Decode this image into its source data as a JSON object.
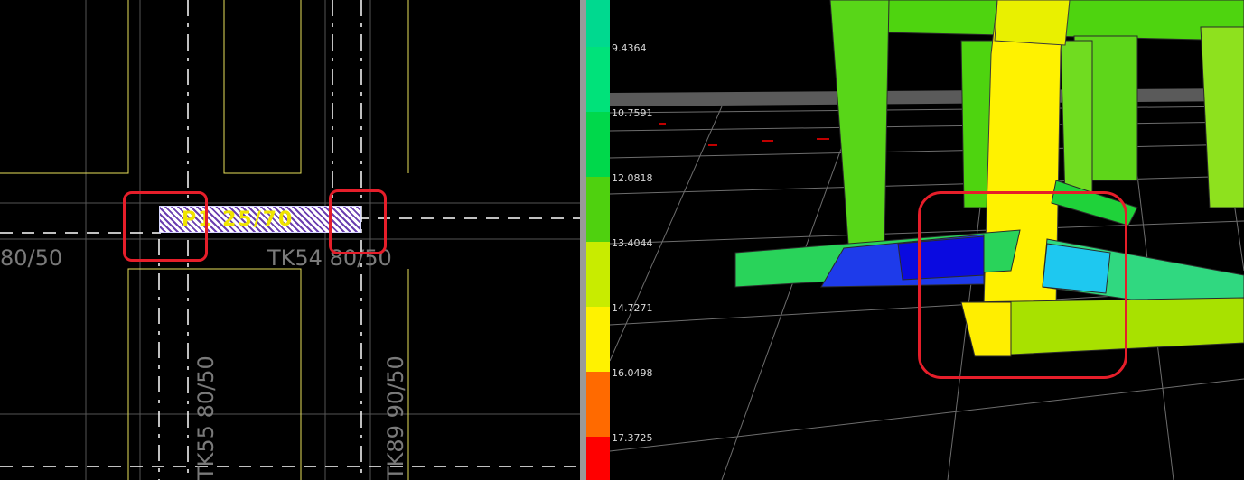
{
  "left_view": {
    "beam_label": "P1 25/70",
    "labels": {
      "tk_80_50_left": "80/50",
      "tk54": "TK54 80/50",
      "tk55": "TK55 80/50",
      "tk89": "TK89 90/50"
    }
  },
  "right_view": {
    "legend": [
      {
        "value": "9.4364",
        "color": "#00e27a"
      },
      {
        "value": "10.7591",
        "color": "#00d84b"
      },
      {
        "value": "12.0818",
        "color": "#4fd10f"
      },
      {
        "value": "13.4044",
        "color": "#c8ec00"
      },
      {
        "value": "14.7271",
        "color": "#fff200"
      },
      {
        "value": "16.0498",
        "color": "#ff9d00"
      },
      {
        "value": "17.3725",
        "color": "#ff4a00"
      }
    ],
    "legend_top_color": "#00d98f",
    "legend_bottom_color": "#ff0000"
  },
  "colors": {
    "highlight": "#e61e2a",
    "cad_yellow": "#e7e05a",
    "cad_gray": "#7a7a7a"
  }
}
